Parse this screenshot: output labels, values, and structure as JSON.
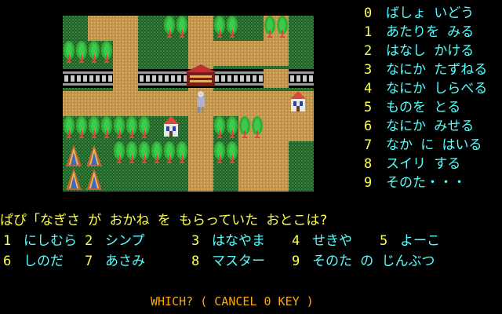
{
  "commands": [
    {
      "num": "0",
      "label": "ばしょ いどう"
    },
    {
      "num": "1",
      "label": "あたりを みる"
    },
    {
      "num": "2",
      "label": "はなし かける"
    },
    {
      "num": "3",
      "label": "なにか たずねる"
    },
    {
      "num": "4",
      "label": "なにか しらべる"
    },
    {
      "num": "5",
      "label": "ものを とる"
    },
    {
      "num": "6",
      "label": "なにか みせる"
    },
    {
      "num": "7",
      "label": "なか に はいる"
    },
    {
      "num": "8",
      "label": "スイリ する"
    },
    {
      "num": "9",
      "label": "そのた・・・"
    }
  ],
  "question": "ぱぴ「なぎさ が おかね を もらっていた おとこは?",
  "characters": [
    {
      "num": "1",
      "label": "にしむら"
    },
    {
      "num": "2",
      "label": "シンプ"
    },
    {
      "num": "3",
      "label": "はなやま"
    },
    {
      "num": "4",
      "label": "せきや"
    },
    {
      "num": "5",
      "label": "よーこ"
    },
    {
      "num": "6",
      "label": "しのだ"
    },
    {
      "num": "7",
      "label": "あさみ"
    },
    {
      "num": "8",
      "label": "マスター"
    },
    {
      "num": "9",
      "label": "そのた の じんぶつ"
    }
  ],
  "prompt": "WHICH? ( CANCEL 0 KEY )",
  "colors": {
    "road": "#c89a4a",
    "grass": "#2e7a3a",
    "tree": "#2fae3a",
    "trunk": "#d84a3a",
    "rail": "#8a8a8a",
    "text_number": "#ffff55",
    "text_label": "#55ffff"
  }
}
